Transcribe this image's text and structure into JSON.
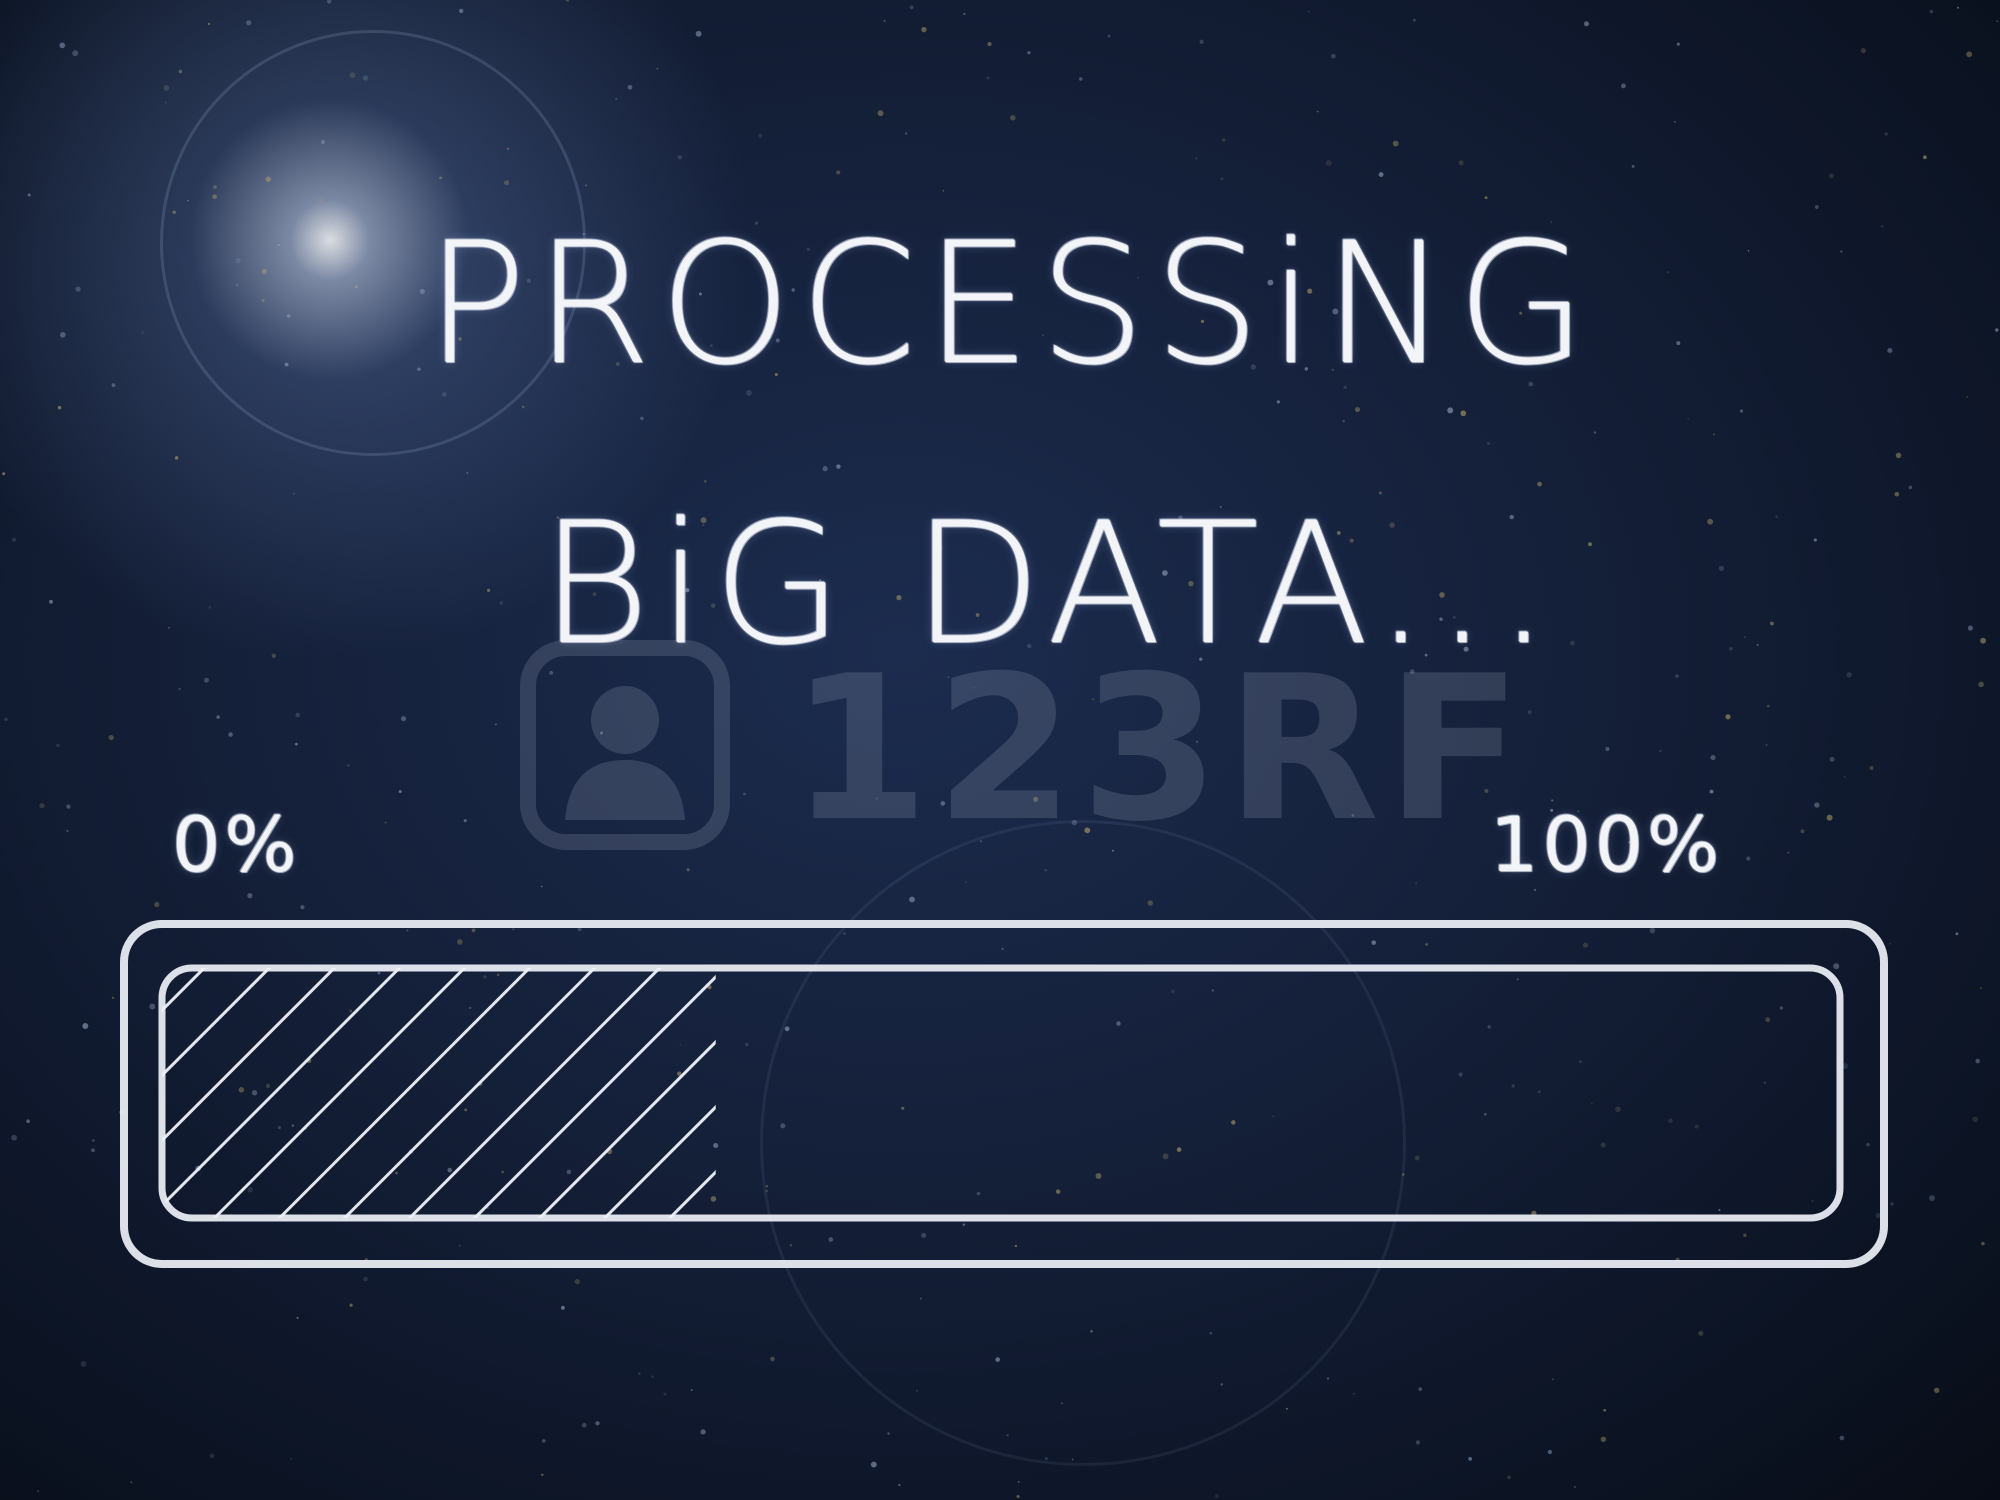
{
  "title": {
    "line1": "PROCESSiNG",
    "line2": "BiG DATA..."
  },
  "progress": {
    "start_label": "0%",
    "end_label": "100%",
    "value": 0.33
  },
  "watermark": {
    "text": "123RF"
  },
  "colors": {
    "chalk": "#f2f4f8",
    "board": "#141f38"
  }
}
